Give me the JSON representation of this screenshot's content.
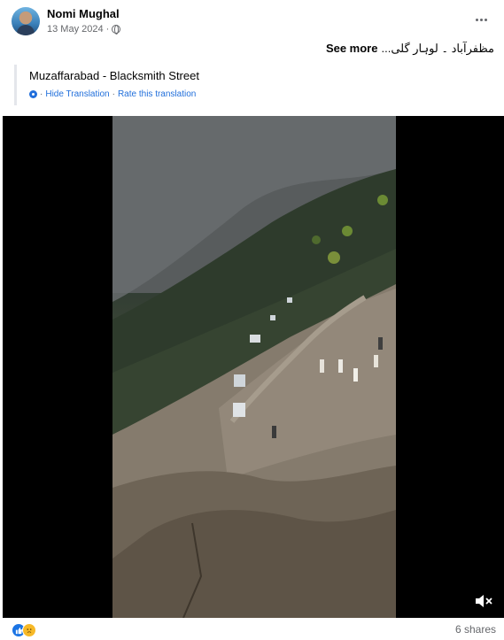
{
  "post": {
    "author": "Nomi Mughal",
    "date": "13 May 2024",
    "date_separator": "·",
    "audience_icon": "globe-icon",
    "original_text": "مظفرآباد ۔ لوہار گلی...",
    "see_more_label": "See more",
    "translation": {
      "text": "Muzaffarabad - Blacksmith Street",
      "hide_label": "Hide Translation",
      "separator": "·",
      "rate_label": "Rate this translation"
    },
    "shares": "6 shares",
    "reactions": [
      "like-icon",
      "sad-icon"
    ]
  },
  "colors": {
    "link": "#216fdb",
    "muted": "#65676b",
    "like": "#1b74e4",
    "sad": "#f7b928"
  }
}
